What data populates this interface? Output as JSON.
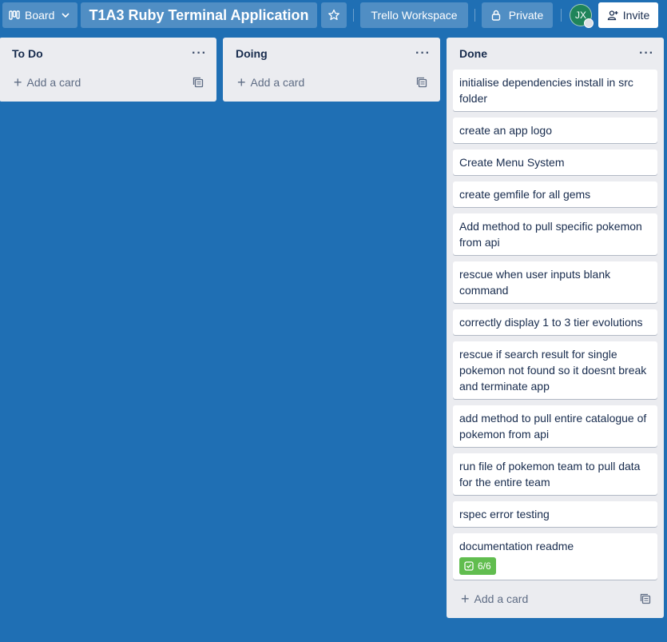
{
  "header": {
    "view_label": "Board",
    "board_title": "T1A3 Ruby Terminal Application",
    "workspace_label": "Trello Workspace",
    "visibility_label": "Private",
    "avatar_initials": "JX",
    "invite_label": "Invite"
  },
  "icons": {
    "view": "board-icon",
    "chevron": "chevron-down-icon",
    "star": "star-icon",
    "lock": "lock-icon",
    "invite": "add-person-icon",
    "more": "more-icon",
    "plus": "plus-icon",
    "template": "card-template-icon",
    "checklist": "checklist-icon"
  },
  "colors": {
    "board_bg": "#1f6fb4",
    "list_bg": "#ebecf0",
    "checklist_complete": "#61bd4f",
    "avatar_bg": "#1f845a"
  },
  "lists": [
    {
      "title": "To Do",
      "menu": "···",
      "add_card_label": "Add a card",
      "cards": []
    },
    {
      "title": "Doing",
      "menu": "···",
      "add_card_label": "Add a card",
      "cards": []
    },
    {
      "title": "Done",
      "menu": "···",
      "add_card_label": "Add a card",
      "cards": [
        {
          "text": "initialise dependencies install in src folder"
        },
        {
          "text": "create an app logo"
        },
        {
          "text": "Create Menu System"
        },
        {
          "text": "create gemfile for all gems"
        },
        {
          "text": "Add method to pull specific pokemon from api"
        },
        {
          "text": "rescue when user inputs blank command"
        },
        {
          "text": "correctly display 1 to 3 tier evolutions"
        },
        {
          "text": "rescue if search result for single pokemon not found so it doesnt break and terminate app"
        },
        {
          "text": "add method to pull entire catalogue of pokemon from api"
        },
        {
          "text": "run file of pokemon team to pull data for the entire team"
        },
        {
          "text": "rspec error testing"
        },
        {
          "text": "documentation readme",
          "checklist": "6/6"
        }
      ]
    }
  ]
}
